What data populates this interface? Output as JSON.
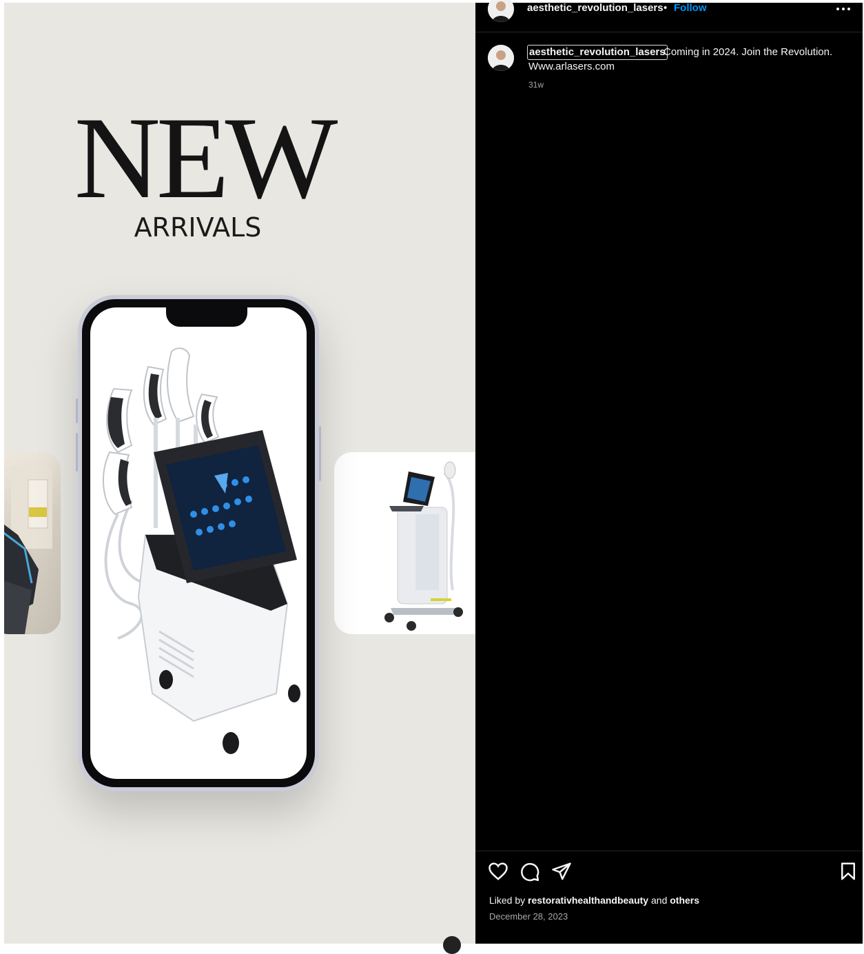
{
  "media": {
    "headline": "NEW",
    "subheadline": "ARRIVALS"
  },
  "post": {
    "author": "aesthetic_revolution_lasers",
    "separator": "•",
    "follow_label": "Follow",
    "caption_user": "aesthetic_revolution_lasers",
    "caption_text": "Coming in 2024. Join the Revolution.",
    "caption_url": "Www.arlasers.com",
    "caption_age": "31w",
    "liked_prefix": "Liked by",
    "liked_user": "restorativhealthandbeauty",
    "liked_and": "and",
    "liked_others": "others",
    "date": "December 28, 2023"
  },
  "icons": {
    "more": "more-options-icon",
    "like": "heart-icon",
    "comment": "comment-icon",
    "share": "send-icon",
    "save": "bookmark-icon"
  },
  "colors": {
    "panel_bg": "#000000",
    "media_bg": "#e8e7e2",
    "follow": "#0095f6",
    "muted": "#a8a8a8"
  }
}
